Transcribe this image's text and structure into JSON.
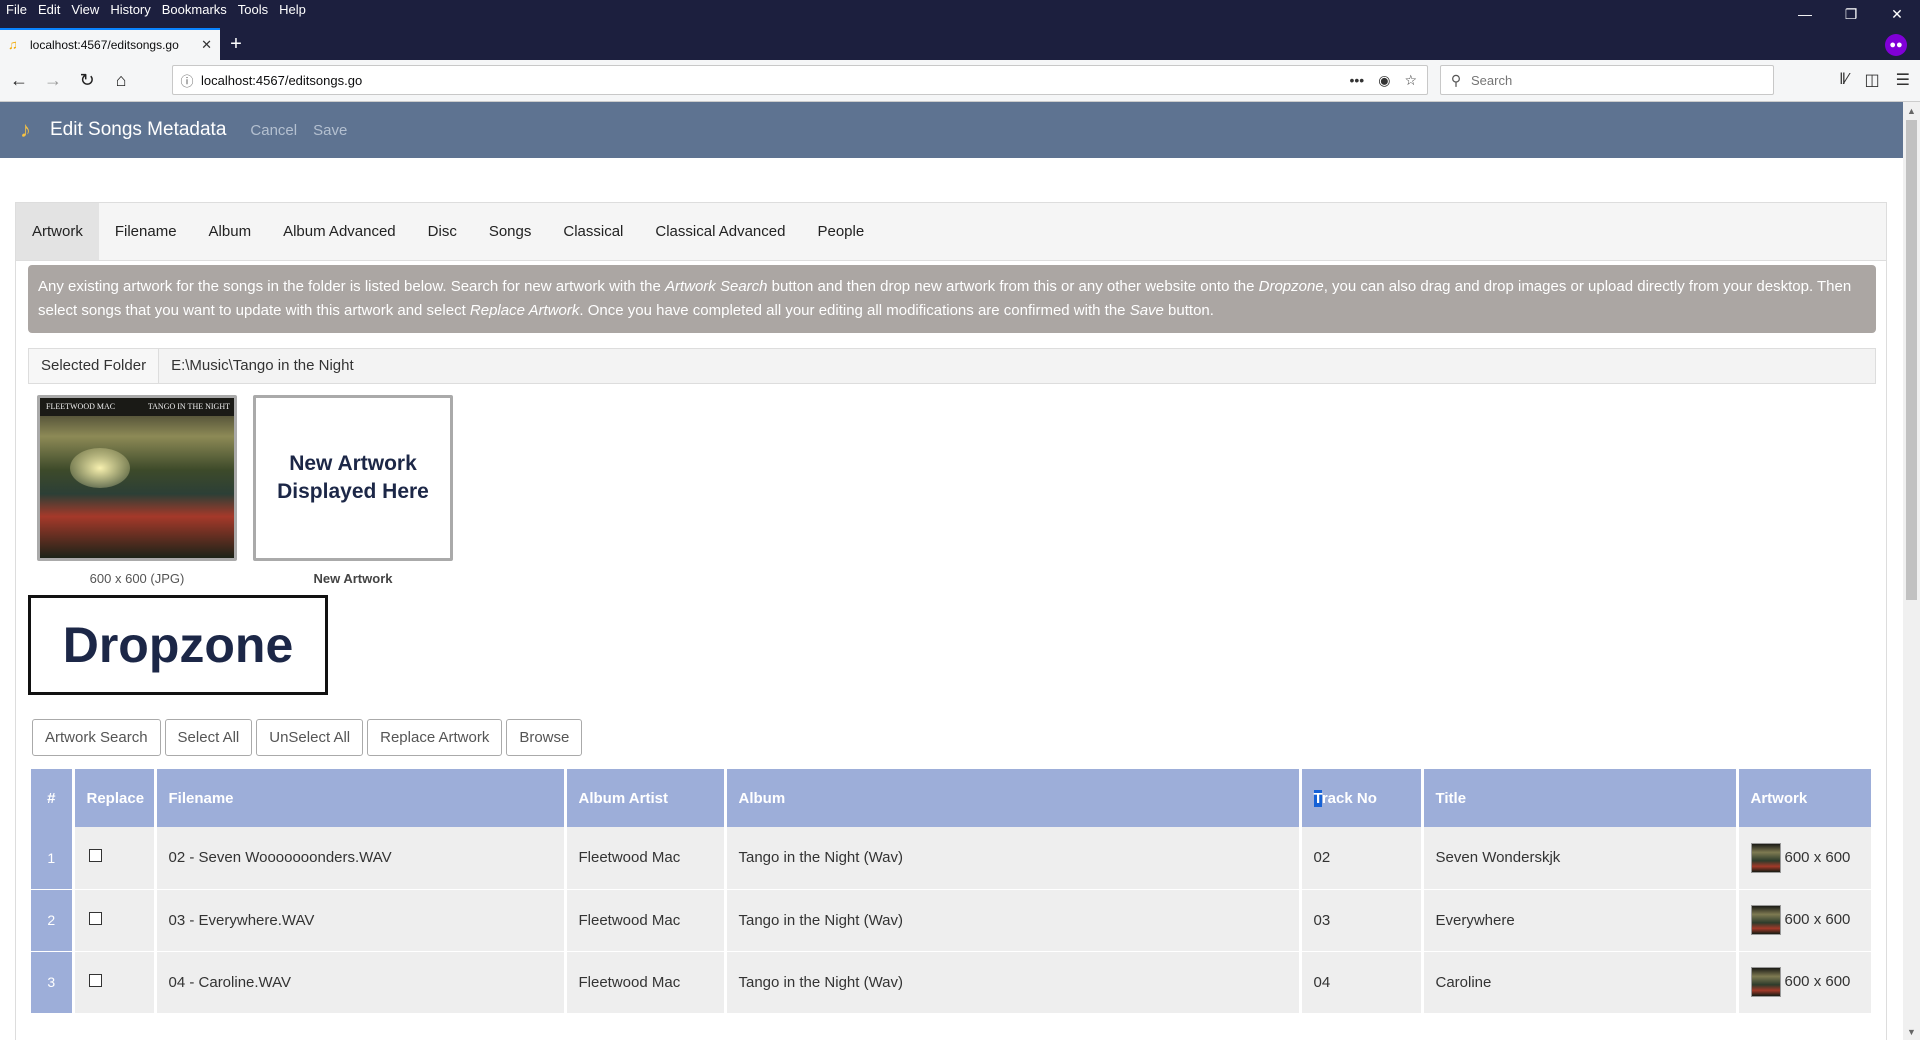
{
  "browser": {
    "menu": [
      "File",
      "Edit",
      "View",
      "History",
      "Bookmarks",
      "Tools",
      "Help"
    ],
    "tab_title": "localhost:4567/editsongs.go",
    "url": "localhost:4567/editsongs.go",
    "search_placeholder": "Search"
  },
  "app": {
    "brand": "Edit Songs Metadata",
    "cancel": "Cancel",
    "save": "Save"
  },
  "tabs": [
    "Artwork",
    "Filename",
    "Album",
    "Album Advanced",
    "Disc",
    "Songs",
    "Classical",
    "Classical Advanced",
    "People"
  ],
  "active_tab": "Artwork",
  "info": {
    "p1": "Any existing artwork for the songs in the folder is listed below. Search for new artwork with the ",
    "em1": "Artwork Search",
    "p2": " button and then drop new artwork from this or any other website onto the ",
    "em2": "Dropzone",
    "p3": ", you can also drag and drop images or upload directly from your desktop. Then select songs that you want to update with this artwork and select ",
    "em3": "Replace Artwork",
    "p4": ". Once you have completed all your editing all modifications are confirmed with the ",
    "em4": "Save",
    "p5": " button."
  },
  "folder": {
    "label": "Selected Folder",
    "value": "E:\\Music\\Tango in the Night"
  },
  "artwork": {
    "existing_caption": "600 x 600 (JPG)",
    "existing_top_left": "FLEETWOOD MAC",
    "existing_top_right": "TANGO IN THE NIGHT",
    "new_line1": "New Artwork",
    "new_line2": "Displayed Here",
    "new_caption": "New Artwork"
  },
  "dropzone": "Dropzone",
  "buttons": {
    "artwork_search": "Artwork Search",
    "select_all": "Select All",
    "unselect_all": "UnSelect All",
    "replace_artwork": "Replace Artwork",
    "browse": "Browse"
  },
  "table": {
    "headers": {
      "num": "#",
      "replace": "Replace",
      "filename": "Filename",
      "album_artist": "Album Artist",
      "album": "Album",
      "track_no_sel": "T",
      "track_no_rest": "rack No",
      "title": "Title",
      "artwork": "Artwork"
    },
    "rows": [
      {
        "num": "1",
        "filename": "02 - Seven Wooooooonders.WAV",
        "album_artist": "Fleetwood Mac",
        "album": "Tango in the Night (Wav)",
        "track": "02",
        "title": "Seven Wonderskjk",
        "artwork": "600 x 600"
      },
      {
        "num": "2",
        "filename": "03 - Everywhere.WAV",
        "album_artist": "Fleetwood Mac",
        "album": "Tango in the Night (Wav)",
        "track": "03",
        "title": "Everywhere",
        "artwork": "600 x 600"
      },
      {
        "num": "3",
        "filename": "04 - Caroline.WAV",
        "album_artist": "Fleetwood Mac",
        "album": "Tango in the Night (Wav)",
        "track": "04",
        "title": "Caroline",
        "artwork": "600 x 600"
      }
    ]
  },
  "colors": {
    "titlebar": "#1c1f3e",
    "appbar": "#5e7391",
    "table_header": "#9daed9",
    "info_box": "#aba6a3"
  }
}
